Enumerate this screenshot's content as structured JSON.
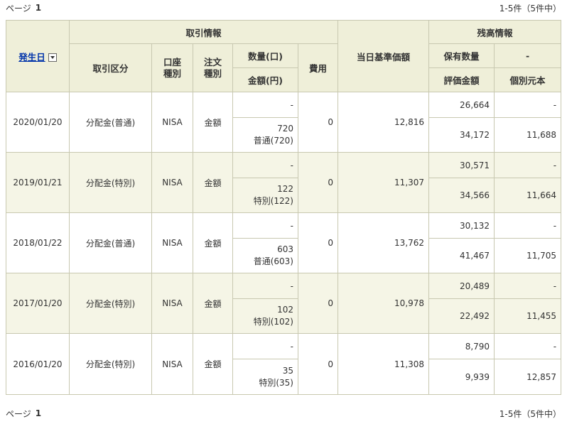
{
  "pager": {
    "page_label": "ページ",
    "page_number": "1",
    "count_text": "1-5件（5件中）"
  },
  "header": {
    "date_sort_label": "発生日",
    "trade_info": "取引情報",
    "trade_type": "取引区分",
    "account_type": "口座\n種別",
    "order_type": "注文\n種別",
    "quantity": "数量(口)",
    "amount": "金額(円)",
    "fee": "費用",
    "base_price": "当日基準価額",
    "balance_info": "残高情報",
    "holding_qty": "保有数量",
    "holding_dash": "-",
    "valuation": "評価金額",
    "principal": "個別元本"
  },
  "rows": [
    {
      "date": "2020/01/20",
      "type": "分配金(普通)",
      "account": "NISA",
      "order": "金額",
      "qty": "-",
      "amount": "720",
      "amount_note": "普通(720)",
      "fee": "0",
      "base_price": "12,816",
      "holding": "26,664",
      "holding_sub": "-",
      "valuation": "34,172",
      "principal": "11,688"
    },
    {
      "date": "2019/01/21",
      "type": "分配金(特別)",
      "account": "NISA",
      "order": "金額",
      "qty": "-",
      "amount": "122",
      "amount_note": "特別(122)",
      "fee": "0",
      "base_price": "11,307",
      "holding": "30,571",
      "holding_sub": "-",
      "valuation": "34,566",
      "principal": "11,664"
    },
    {
      "date": "2018/01/22",
      "type": "分配金(普通)",
      "account": "NISA",
      "order": "金額",
      "qty": "-",
      "amount": "603",
      "amount_note": "普通(603)",
      "fee": "0",
      "base_price": "13,762",
      "holding": "30,132",
      "holding_sub": "-",
      "valuation": "41,467",
      "principal": "11,705"
    },
    {
      "date": "2017/01/20",
      "type": "分配金(特別)",
      "account": "NISA",
      "order": "金額",
      "qty": "-",
      "amount": "102",
      "amount_note": "特別(102)",
      "fee": "0",
      "base_price": "10,978",
      "holding": "20,489",
      "holding_sub": "-",
      "valuation": "22,492",
      "principal": "11,455"
    },
    {
      "date": "2016/01/20",
      "type": "分配金(特別)",
      "account": "NISA",
      "order": "金額",
      "qty": "-",
      "amount": "35",
      "amount_note": "特別(35)",
      "fee": "0",
      "base_price": "11,308",
      "holding": "8,790",
      "holding_sub": "-",
      "valuation": "9,939",
      "principal": "12,857"
    }
  ],
  "colors": {
    "header_bg": "#efefd9",
    "alt_row_bg": "#f5f5e6",
    "border": "#c8c8b0",
    "link": "#0033aa"
  }
}
